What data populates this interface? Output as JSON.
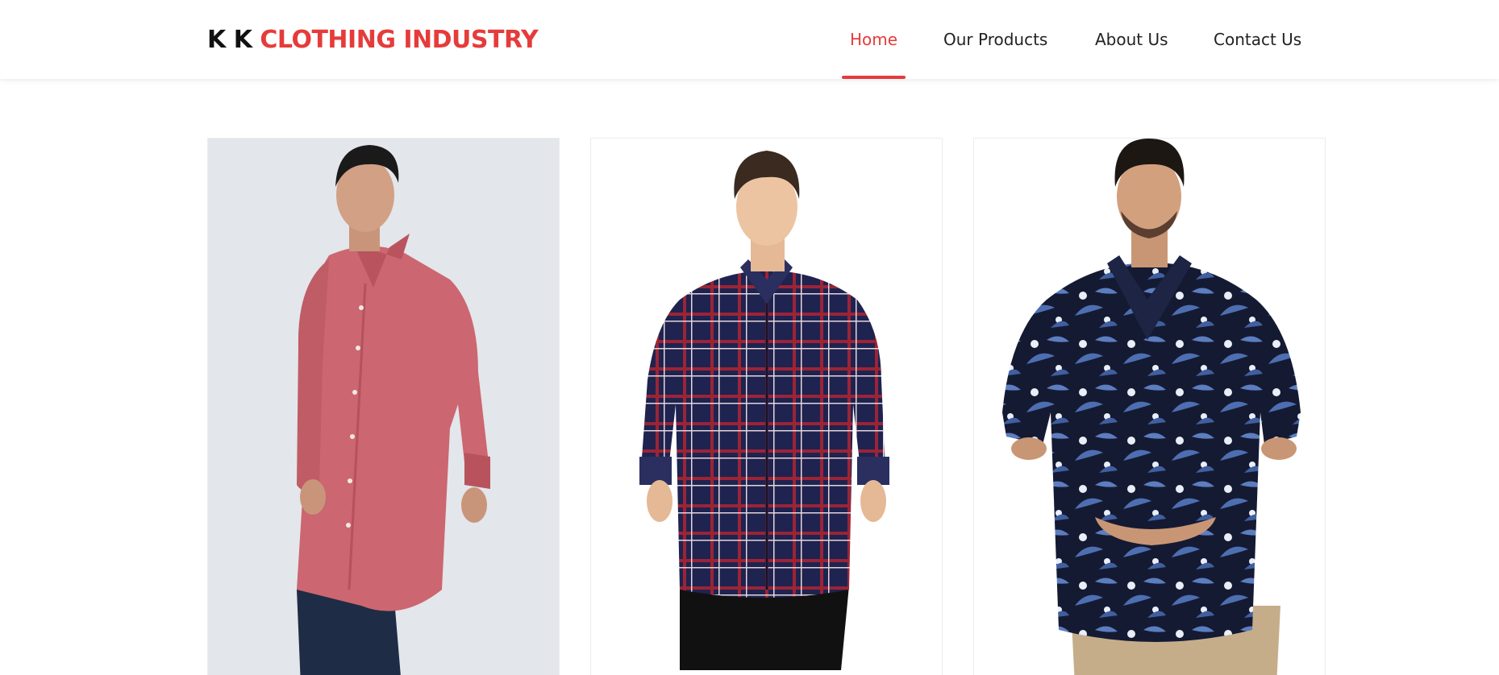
{
  "brand": {
    "prefix": "K K",
    "name": "CLOTHING INDUSTRY"
  },
  "nav": {
    "items": [
      {
        "label": "Home",
        "active": true
      },
      {
        "label": "Our Products",
        "active": false
      },
      {
        "label": "About Us",
        "active": false
      },
      {
        "label": "Contact Us",
        "active": false
      }
    ]
  },
  "colors": {
    "accent": "#e63b3b",
    "text": "#222222"
  },
  "products": [
    {
      "image": "model-in-pink-dotted-shirt",
      "background": "#e3e6ea"
    },
    {
      "image": "model-in-navy-red-checked-shirt",
      "background": "#ffffff"
    },
    {
      "image": "model-in-navy-floral-print-shirt",
      "background": "#ffffff"
    }
  ]
}
